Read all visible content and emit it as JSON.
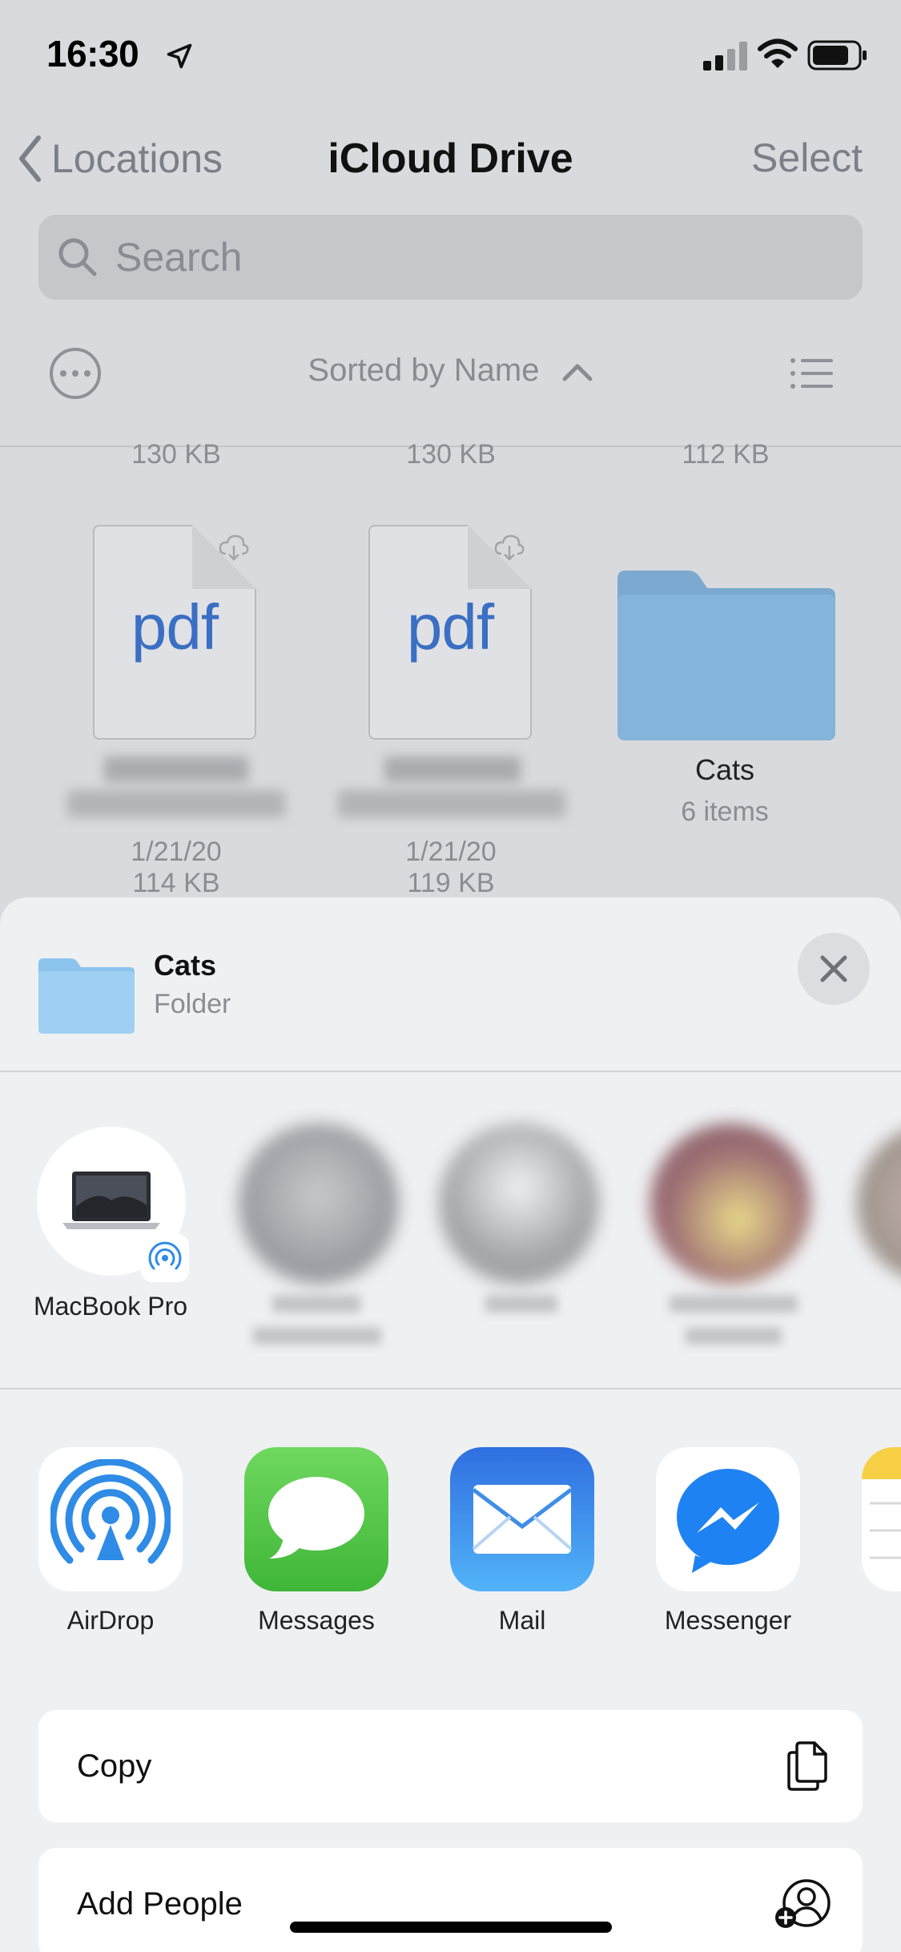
{
  "status_bar": {
    "time": "16:30",
    "icons": [
      "location-arrow-icon",
      "signal-icon",
      "wifi-icon",
      "battery-icon"
    ]
  },
  "nav": {
    "back_label": "Locations",
    "title": "iCloud Drive",
    "select_label": "Select"
  },
  "search": {
    "placeholder": "Search"
  },
  "toolbar": {
    "sort_label": "Sorted by Name"
  },
  "files": {
    "top_sizes": [
      "130 KB",
      "130 KB",
      "112 KB"
    ],
    "items": [
      {
        "kind": "pdf",
        "thumb_text": "pdf",
        "date": "1/21/20",
        "size": "114 KB"
      },
      {
        "kind": "pdf",
        "thumb_text": "pdf",
        "date": "1/21/20",
        "size": "119 KB"
      },
      {
        "kind": "folder",
        "name": "Cats",
        "count": "6 items"
      }
    ]
  },
  "share_sheet": {
    "header": {
      "title": "Cats",
      "subtitle": "Folder"
    },
    "airdrop_target": {
      "label": "MacBook Pro"
    },
    "apps": [
      {
        "label": "AirDrop",
        "icon": "airdrop-icon"
      },
      {
        "label": "Messages",
        "icon": "messages-icon"
      },
      {
        "label": "Mail",
        "icon": "mail-icon"
      },
      {
        "label": "Messenger",
        "icon": "messenger-icon"
      }
    ],
    "actions": [
      {
        "label": "Copy",
        "icon": "copy-icon"
      },
      {
        "label": "Add People",
        "icon": "add-people-icon"
      }
    ]
  },
  "colors": {
    "accent_blue": "#3a6fc4",
    "folder_blue": "#7fb0d8",
    "messages_green": "#5ec64f",
    "mail_blue": "#3f8ee8",
    "messenger_blue": "#1f82f2"
  }
}
